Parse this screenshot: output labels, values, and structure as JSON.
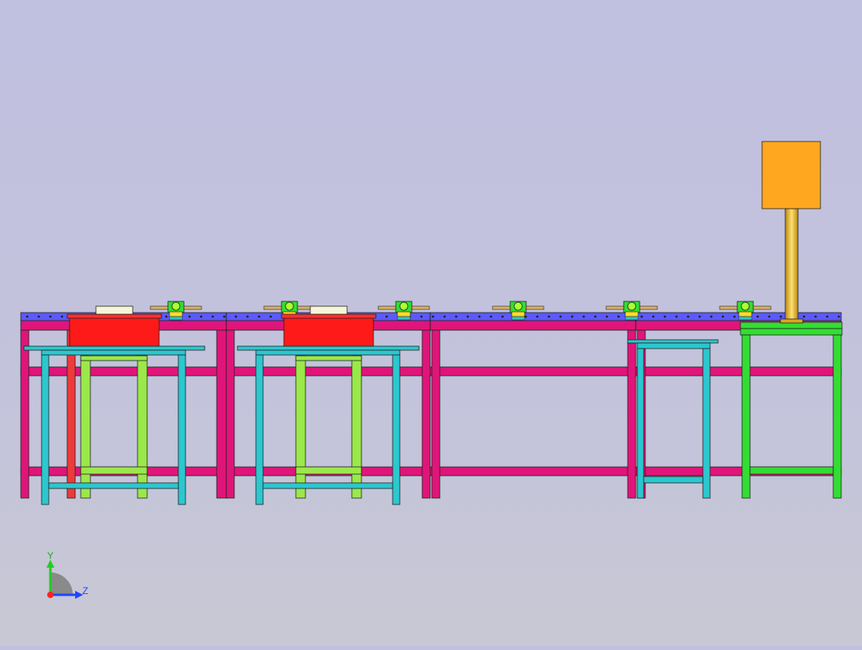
{
  "viewport": {
    "background_top": "#c0c0e0",
    "background_bottom": "#c8c8d4"
  },
  "colors": {
    "frame_magenta": "#e0157a",
    "conveyor_top": "#5a5aff",
    "table_cyan": "#2cc7cf",
    "table_lime": "#9be84a",
    "red_box": "#ff1a1a",
    "orange_cabinet": "#ffa81f",
    "pillar_gold": "#d8a820",
    "green_stand": "#33dd33"
  },
  "triad": {
    "y_label": "Y",
    "z_label": "Z",
    "y_color": "#22cc22",
    "z_color": "#2244ff",
    "x_color": "#ff2222"
  }
}
